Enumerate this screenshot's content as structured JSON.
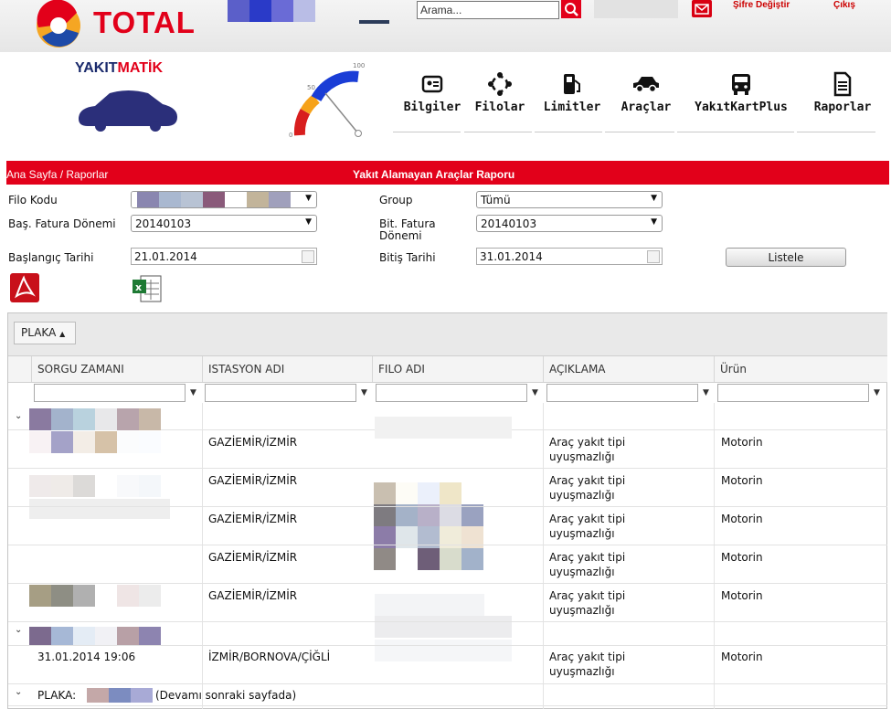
{
  "topbar": {
    "brand": "TOTAL",
    "search_placeholder": "Arama...",
    "links": [
      "Şifre Değiştir",
      "Çıkış"
    ]
  },
  "header": {
    "product_logo": {
      "part1": "YAKIT",
      "part2": "MATİK"
    },
    "gauge": {
      "scale_labels": [
        "0",
        "50",
        "100"
      ]
    },
    "nav": [
      "Bilgiler",
      "Filolar",
      "Limitler",
      "Araçlar",
      "YakıtKartPlus",
      "Raporlar"
    ]
  },
  "titlebar": {
    "breadcrumb": "Ana Sayfa / Raporlar",
    "title": "Yakıt Alamayan Araçlar Raporu"
  },
  "form": {
    "filo_kodu_label": "Filo Kodu",
    "group_label": "Group",
    "group_value": "Tümü",
    "bas_fatura_label": "Baş. Fatura Dönemi",
    "bas_fatura_value": "20140103",
    "bit_fatura_label_1": "Bit. Fatura",
    "bit_fatura_label_2": "Dönemi",
    "bit_fatura_value": "20140103",
    "baslangic_label": "Başlangıç Tarihi",
    "baslangic_value": "21.01.2014",
    "bitis_label": "Bitiş Tarihi",
    "bitis_value": "31.01.2014",
    "listele_label": "Listele"
  },
  "grid": {
    "group_button": "PLAKA",
    "columns": [
      "SORGU ZAMANI",
      "ISTASYON ADI",
      "FILO ADI",
      "AÇIKLAMA",
      "Ürün"
    ],
    "rows": [
      {
        "sorgu_zamani": "",
        "istasyon": "GAZİEMİR/İZMİR",
        "aciklama_1": "Araç yakıt tipi",
        "aciklama_2": "uyuşmazlığı",
        "urun": "Motorin"
      },
      {
        "sorgu_zamani": "",
        "istasyon": "GAZİEMİR/İZMİR",
        "aciklama_1": "Araç yakıt tipi",
        "aciklama_2": "uyuşmazlığı",
        "urun": "Motorin"
      },
      {
        "sorgu_zamani": "",
        "istasyon": "GAZİEMİR/İZMİR",
        "aciklama_1": "Araç yakıt tipi",
        "aciklama_2": "uyuşmazlığı",
        "urun": "Motorin"
      },
      {
        "sorgu_zamani": "",
        "istasyon": "GAZİEMİR/İZMİR",
        "aciklama_1": "Araç yakıt tipi",
        "aciklama_2": "uyuşmazlığı",
        "urun": "Motorin"
      },
      {
        "sorgu_zamani": "",
        "istasyon": "GAZİEMİR/İZMİR",
        "aciklama_1": "Araç yakıt tipi",
        "aciklama_2": "uyuşmazlığı",
        "urun": "Motorin"
      },
      {
        "sorgu_zamani": "31.01.2014 19:06",
        "istasyon": "İZMİR/BORNOVA/ÇİĞLİ",
        "aciklama_1": "Araç yakıt tipi",
        "aciklama_2": "uyuşmazlığı",
        "urun": "Motorin"
      }
    ],
    "footer_group_label": "PLAKA:",
    "footer_group_note": "(Devamı sonraki sayfada)"
  },
  "colors": {
    "brand_red": "#e2001a",
    "panel_grey": "#e9e9e9"
  }
}
